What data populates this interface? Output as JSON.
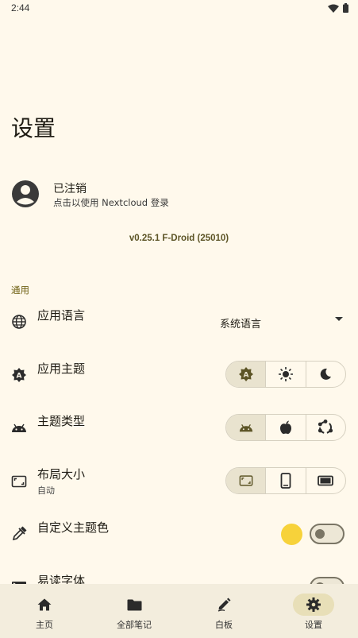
{
  "status_bar": {
    "time": "2:44",
    "icons": [
      "wifi-icon",
      "battery-icon"
    ]
  },
  "page_title": "设置",
  "account": {
    "name": "已注销",
    "subtitle": "点击以使用 Nextcloud 登录",
    "icon": "account-circle-icon"
  },
  "version": "v0.25.1 F-Droid (25010)",
  "sections": {
    "general": "通用"
  },
  "settings": {
    "app_language": {
      "title": "应用语言",
      "value": "系统语言",
      "icon": "globe-icon"
    },
    "app_theme": {
      "title": "应用主题",
      "icon": "auto-theme-icon",
      "options": [
        "auto-theme-icon",
        "sun-icon",
        "moon-icon"
      ],
      "selected": 0
    },
    "theme_type": {
      "title": "主题类型",
      "icon": "android-icon",
      "options": [
        "android-icon",
        "apple-icon",
        "ubuntu-icon"
      ],
      "selected": 0
    },
    "layout_size": {
      "title": "布局大小",
      "subtitle": "自动",
      "icon": "aspect-ratio-icon",
      "options": [
        "aspect-ratio-icon",
        "phone-icon",
        "tablet-icon"
      ],
      "selected": 0
    },
    "custom_theme_color": {
      "title": "自定义主题色",
      "icon": "eyedropper-icon",
      "color": "#F7D23A",
      "enabled": false
    },
    "readable_font": {
      "title": "易读字体",
      "icon": "font-icon",
      "enabled": false
    }
  },
  "bottom_nav": {
    "items": [
      {
        "label": "主页",
        "icon": "home-icon"
      },
      {
        "label": "全部笔记",
        "icon": "folder-icon"
      },
      {
        "label": "白板",
        "icon": "draw-icon"
      },
      {
        "label": "设置",
        "icon": "gear-icon"
      }
    ],
    "active": 3
  },
  "colors": {
    "background": "#FFF9EC",
    "accent": "#6D5E0F",
    "nav_background": "#F3EDDD",
    "nav_active_pill": "#E8DFB8"
  }
}
